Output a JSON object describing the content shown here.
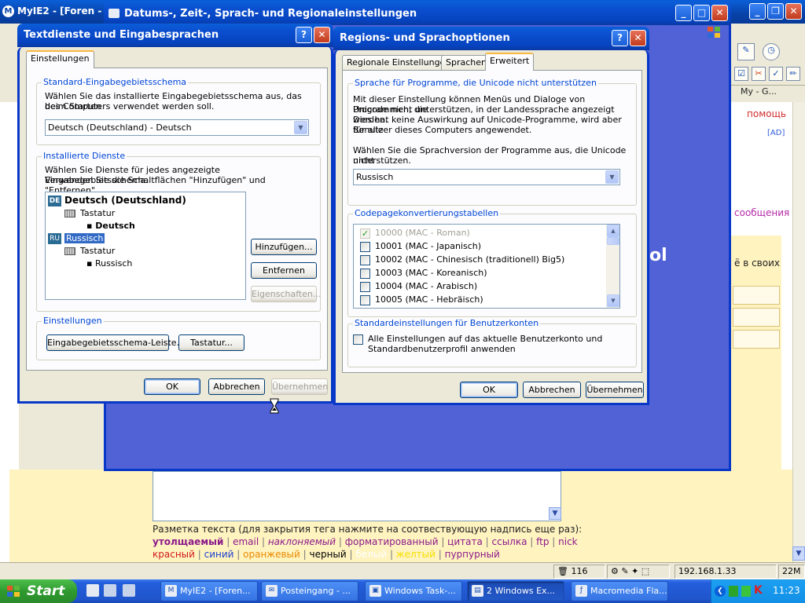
{
  "browser": {
    "title": "MyIE2 - [Foren - C",
    "app_icon": "M",
    "my_tab": "My - G...",
    "help_link": "помощь",
    "ad_label": "[AD]",
    "messages_link": "сообщения",
    "in_own": "ё в своих",
    "markup_title": "Разметка текста (для закрытия тега нажмите на соотвествующую надпись еще раз):",
    "markup_line1": [
      {
        "text": "утолщаемый",
        "color": "#8b1a8b",
        "bold": true,
        "italic": false
      },
      {
        "text": "email",
        "color": "#8b1a8b",
        "bold": false,
        "italic": false
      },
      {
        "text": "наклоняемый",
        "color": "#8b1a8b",
        "bold": false,
        "italic": true
      },
      {
        "text": "форматированный",
        "color": "#8b1a8b",
        "bold": false,
        "italic": false
      },
      {
        "text": "цитата",
        "color": "#8b1a8b",
        "bold": false,
        "italic": false
      },
      {
        "text": "ссылка",
        "color": "#8b1a8b",
        "bold": false,
        "italic": false
      },
      {
        "text": "ftp",
        "color": "#8b1a8b",
        "bold": false,
        "italic": false
      },
      {
        "text": "nick",
        "color": "#8b1a8b",
        "bold": false,
        "italic": false
      }
    ],
    "markup_line2": [
      {
        "text": "красный",
        "color": "#d11a1a"
      },
      {
        "text": "синий",
        "color": "#1a3fd1"
      },
      {
        "text": "оранжевый",
        "color": "#e88a00"
      },
      {
        "text": "черный",
        "color": "#000000"
      },
      {
        "text": "белый",
        "color": "#ffffff"
      },
      {
        "text": "желтый",
        "color": "#f5e000"
      },
      {
        "text": "пурпурный",
        "color": "#8b1a8b"
      }
    ]
  },
  "status_bar": {
    "count": "116",
    "ip": "192.168.1.33",
    "memory": "22M"
  },
  "taskbar": {
    "start_label": "Start",
    "buttons": [
      {
        "label": "MyIE2 - [Foren...",
        "icon": "M"
      },
      {
        "label": "Posteingang - ...",
        "icon": "✉"
      },
      {
        "label": "Windows Task-...",
        "icon": "▣"
      },
      {
        "label": "2 Windows Ex...",
        "icon": "▤"
      },
      {
        "label": "Macromedia Fla...",
        "icon": "ƒ"
      }
    ],
    "clock": "11:23"
  },
  "regional_window": {
    "title": "Datums-, Zeit-, Sprach- und Regionaleinstellungen",
    "splash_text": "ol"
  },
  "text_services_dialog": {
    "title": "Textdienste und Eingabesprachen",
    "tab": "Einstellungen",
    "default_group": {
      "title": "Standard-Eingabegebietsschema",
      "description_1": "Wählen Sie das installierte Eingabegebietsschema aus, das beim Starten",
      "description_2": "des Computers verwendet werden soll.",
      "selected": "Deutsch (Deutschland) - Deutsch"
    },
    "installed_group": {
      "title": "Installierte Dienste",
      "description_1": "Wählen Sie Dienste für jedes angezeigte Eingabegebietsschema.",
      "description_2": "Verwenden Sie die Schaltflächen \"Hinzufügen\" und \"Entfernen\".",
      "tree": [
        {
          "code": "DE",
          "label": "Deutsch (Deutschland)"
        },
        {
          "label": "Tastatur"
        },
        {
          "label": "Deutsch"
        },
        {
          "code": "RU",
          "label": "Russisch"
        },
        {
          "label": "Tastatur"
        },
        {
          "label": "Russisch"
        }
      ],
      "add_button": "Hinzufügen...",
      "remove_button": "Entfernen",
      "properties_button": "Eigenschaften..."
    },
    "settings_group": {
      "title": "Einstellungen",
      "langbar_button": "Eingabegebietsschema-Leiste...",
      "keyboard_button": "Tastatur..."
    },
    "ok_button": "OK",
    "cancel_button": "Abbrechen",
    "apply_button": "Übernehmen"
  },
  "regional_dialog": {
    "title": "Regions- und Sprachoptionen",
    "tabs": [
      "Regionale Einstellungen",
      "Sprachen",
      "Erweitert"
    ],
    "unicode_group": {
      "title": "Sprache für Programme, die Unicode nicht unterstützen",
      "description": [
        "Mit dieser Einstellung können Menüs und Dialoge von Programmen, die",
        "Unicode nicht unterstützen, in der Landessprache angezeigt werden.",
        "Dies hat keine Auswirkung auf Unicode-Programme, wird aber für alle",
        "Benutzer dieses Computers angewendet."
      ],
      "choose_1": "Wählen Sie die Sprachversion der Programme aus, die Unicode nicht",
      "choose_2": "unterstützen.",
      "selected": "Russisch"
    },
    "codepage_group": {
      "title": "Codepagekonvertierungstabellen",
      "items": [
        {
          "label": "10000 (MAC - Roman)",
          "checked": true,
          "disabled": true
        },
        {
          "label": "10001 (MAC - Japanisch)",
          "checked": false,
          "disabled": false
        },
        {
          "label": "10002 (MAC - Chinesisch (traditionell) Big5)",
          "checked": false,
          "disabled": false
        },
        {
          "label": "10003 (MAC - Koreanisch)",
          "checked": false,
          "disabled": false
        },
        {
          "label": "10004 (MAC - Arabisch)",
          "checked": false,
          "disabled": false
        },
        {
          "label": "10005 (MAC - Hebräisch)",
          "checked": false,
          "disabled": false
        }
      ]
    },
    "defaults_group": {
      "title": "Standardeinstellungen für Benutzerkonten",
      "checkbox_1": "Alle Einstellungen auf das aktuelle Benutzerkonto und",
      "checkbox_2": "Standardbenutzerprofil anwenden"
    },
    "ok_button": "OK",
    "cancel_button": "Abbrechen",
    "apply_button": "Übernehmen"
  }
}
